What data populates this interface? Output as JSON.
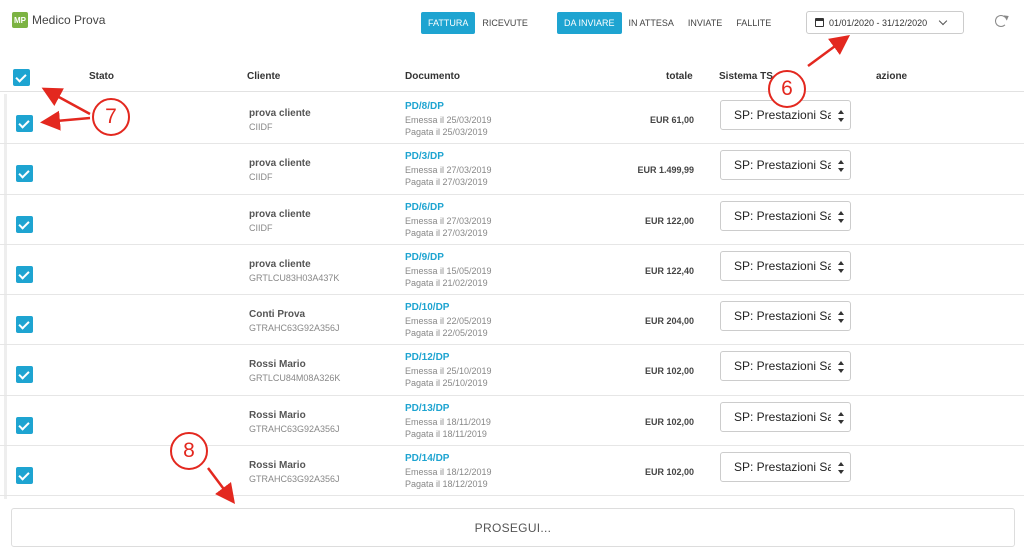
{
  "brand": {
    "logo": "MP",
    "name": "Medico Prova"
  },
  "doc_type_tabs": [
    {
      "label": "FATTURA",
      "active": true
    },
    {
      "label": "RICEVUTE",
      "active": false
    }
  ],
  "status_tabs": [
    {
      "label": "DA INVIARE",
      "active": true
    },
    {
      "label": "IN ATTESA",
      "active": false
    },
    {
      "label": "INVIATE",
      "active": false
    },
    {
      "label": "FALLITE",
      "active": false
    }
  ],
  "date_range": "01/01/2020 - 31/12/2020",
  "table": {
    "headers": {
      "stato": "Stato",
      "cliente": "Cliente",
      "documento": "Documento",
      "totale": "totale",
      "sistema_ts": "Sistema TS",
      "azione": "azione"
    },
    "rows": [
      {
        "cliente": "prova cliente",
        "codice": "CIIDF",
        "numero": "PD/8/DP",
        "emessa": "Emessa il 25/03/2019",
        "pagata": "Pagata il 25/03/2019",
        "totale": "EUR 61,00",
        "sistema": "SP: Prestazioni Sa"
      },
      {
        "cliente": "prova cliente",
        "codice": "CIIDF",
        "numero": "PD/3/DP",
        "emessa": "Emessa il 27/03/2019",
        "pagata": "Pagata il 27/03/2019",
        "totale": "EUR 1.499,99",
        "sistema": "SP: Prestazioni Sa"
      },
      {
        "cliente": "prova cliente",
        "codice": "CIIDF",
        "numero": "PD/6/DP",
        "emessa": "Emessa il 27/03/2019",
        "pagata": "Pagata il 27/03/2019",
        "totale": "EUR 122,00",
        "sistema": "SP: Prestazioni Sa"
      },
      {
        "cliente": "prova cliente",
        "codice": "GRTLCU83H03A437K",
        "numero": "PD/9/DP",
        "emessa": "Emessa il 15/05/2019",
        "pagata": "Pagata il 21/02/2019",
        "totale": "EUR 122,40",
        "sistema": "SP: Prestazioni Sa"
      },
      {
        "cliente": "Conti Prova",
        "codice": "GTRAHC63G92A356J",
        "numero": "PD/10/DP",
        "emessa": "Emessa il 22/05/2019",
        "pagata": "Pagata il 22/05/2019",
        "totale": "EUR 204,00",
        "sistema": "SP: Prestazioni Sa"
      },
      {
        "cliente": "Rossi Mario",
        "codice": "GRTLCU84M08A326K",
        "numero": "PD/12/DP",
        "emessa": "Emessa il 25/10/2019",
        "pagata": "Pagata il 25/10/2019",
        "totale": "EUR 102,00",
        "sistema": "SP: Prestazioni Sa"
      },
      {
        "cliente": "Rossi Mario",
        "codice": "GTRAHC63G92A356J",
        "numero": "PD/13/DP",
        "emessa": "Emessa il 18/11/2019",
        "pagata": "Pagata il 18/11/2019",
        "totale": "EUR 102,00",
        "sistema": "SP: Prestazioni Sa"
      },
      {
        "cliente": "Rossi Mario",
        "codice": "GTRAHC63G92A356J",
        "numero": "PD/14/DP",
        "emessa": "Emessa il 18/12/2019",
        "pagata": "Pagata il 18/12/2019",
        "totale": "EUR 102,00",
        "sistema": "SP: Prestazioni Sa"
      }
    ]
  },
  "prosegui_label": "PROSEGUI...",
  "annotations": {
    "a6": "6",
    "a7": "7",
    "a8": "8"
  },
  "colors": {
    "accent": "#1ea4d1",
    "annotation": "#e3281f",
    "brand": "#7cb342"
  },
  "icons": {
    "date": "calendar-icon",
    "dropdown": "chevron-down-icon",
    "reload": "refresh-icon",
    "check": "checkbox-checked-icon"
  }
}
